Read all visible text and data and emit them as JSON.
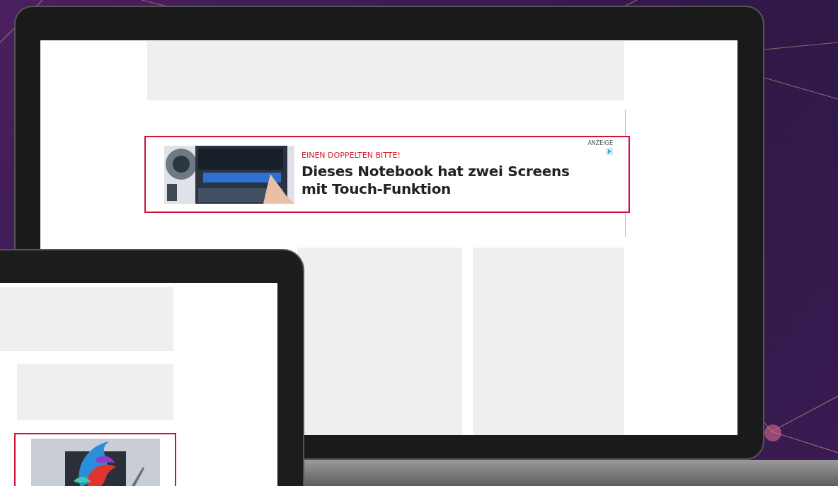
{
  "laptop": {
    "ad": {
      "label": "ANZEIGE",
      "kicker": "EINEN DOPPELTEN BITTE!",
      "headline_lines": [
        "Dieses Notebook hat zwei Screens",
        "mit Touch-Funktion"
      ]
    }
  }
}
